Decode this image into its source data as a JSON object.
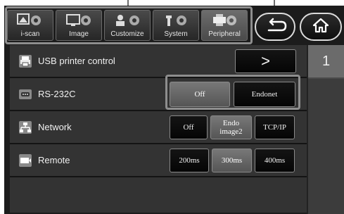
{
  "tabs": [
    {
      "label": "i-scan",
      "icon": "i-scan-icon",
      "active": false
    },
    {
      "label": "Image",
      "icon": "image-icon",
      "active": false
    },
    {
      "label": "Customize",
      "icon": "customize-icon",
      "active": false
    },
    {
      "label": "System",
      "icon": "system-icon",
      "active": false
    },
    {
      "label": "Peripheral",
      "icon": "peripheral-icon",
      "active": true
    }
  ],
  "nav": {
    "back_icon": "back-arrow-icon",
    "home_icon": "home-icon"
  },
  "rows": {
    "usb": {
      "label": "USB printer control",
      "action": ">"
    },
    "rs232": {
      "label": "RS-232C",
      "options": [
        "Off",
        "Endonet"
      ],
      "selected": "Off"
    },
    "network": {
      "label": "Network",
      "options": [
        "Off",
        "Endo image2",
        "TCP/IP"
      ],
      "selected": "Endo image2"
    },
    "remote": {
      "label": "Remote",
      "options": [
        "200ms",
        "300ms",
        "400ms"
      ],
      "selected": "300ms"
    }
  },
  "page": {
    "number": "1"
  },
  "colors": {
    "selected": "#6a6a6a",
    "unselected": "#0a0a0a",
    "screen": "#1c1c1c"
  }
}
